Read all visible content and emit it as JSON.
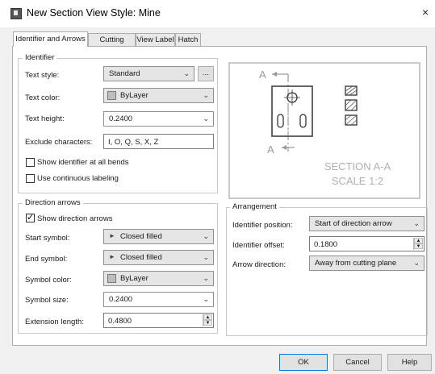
{
  "window": {
    "title": "New Section View Style: Mine",
    "close_glyph": "×"
  },
  "tabs": [
    {
      "label": "Identifier and Arrows",
      "active": true
    },
    {
      "label": "Cutting Plane",
      "active": false
    },
    {
      "label": "View Label",
      "active": false
    },
    {
      "label": "Hatch",
      "active": false
    }
  ],
  "identifier": {
    "legend": "Identifier",
    "text_style": {
      "label": "Text style:",
      "value": "Standard",
      "more_button": "..."
    },
    "text_color": {
      "label": "Text color:",
      "value": "ByLayer"
    },
    "text_height": {
      "label": "Text height:",
      "value": "0.2400"
    },
    "exclude": {
      "label": "Exclude characters:",
      "value": "I, O, Q, S, X, Z"
    },
    "show_all_bends": {
      "label": "Show identifier at all bends",
      "checked": false
    },
    "continuous": {
      "label": "Use continuous labeling",
      "checked": false
    }
  },
  "direction_arrows": {
    "legend": "Direction arrows",
    "show": {
      "label": "Show direction arrows",
      "checked": true
    },
    "start_symbol": {
      "label": "Start symbol:",
      "value": "Closed filled"
    },
    "end_symbol": {
      "label": "End symbol:",
      "value": "Closed filled"
    },
    "symbol_color": {
      "label": "Symbol color:",
      "value": "ByLayer"
    },
    "symbol_size": {
      "label": "Symbol size:",
      "value": "0.2400"
    },
    "extension_length": {
      "label": "Extension length:",
      "value": "0.4800"
    }
  },
  "preview": {
    "label_top": "A",
    "label_bottom": "A",
    "caption_line1": "SECTION A-A",
    "caption_line2": "SCALE 1:2"
  },
  "arrangement": {
    "legend": "Arrangement",
    "identifier_position": {
      "label": "Identifier position:",
      "value": "Start of direction arrow"
    },
    "identifier_offset": {
      "label": "Identifier offset:",
      "value": "0.1800"
    },
    "arrow_direction": {
      "label": "Arrow direction:",
      "value": "Away from cutting plane"
    }
  },
  "buttons": {
    "ok": "OK",
    "cancel": "Cancel",
    "help": "Help"
  },
  "icons": {
    "chevron": "chevron-down-icon",
    "spin_up": "▲",
    "spin_down": "▼",
    "arrow_symbol": "►"
  },
  "colors": {
    "accent": "#0078d7",
    "preview_caption": "#b0b0b0"
  }
}
